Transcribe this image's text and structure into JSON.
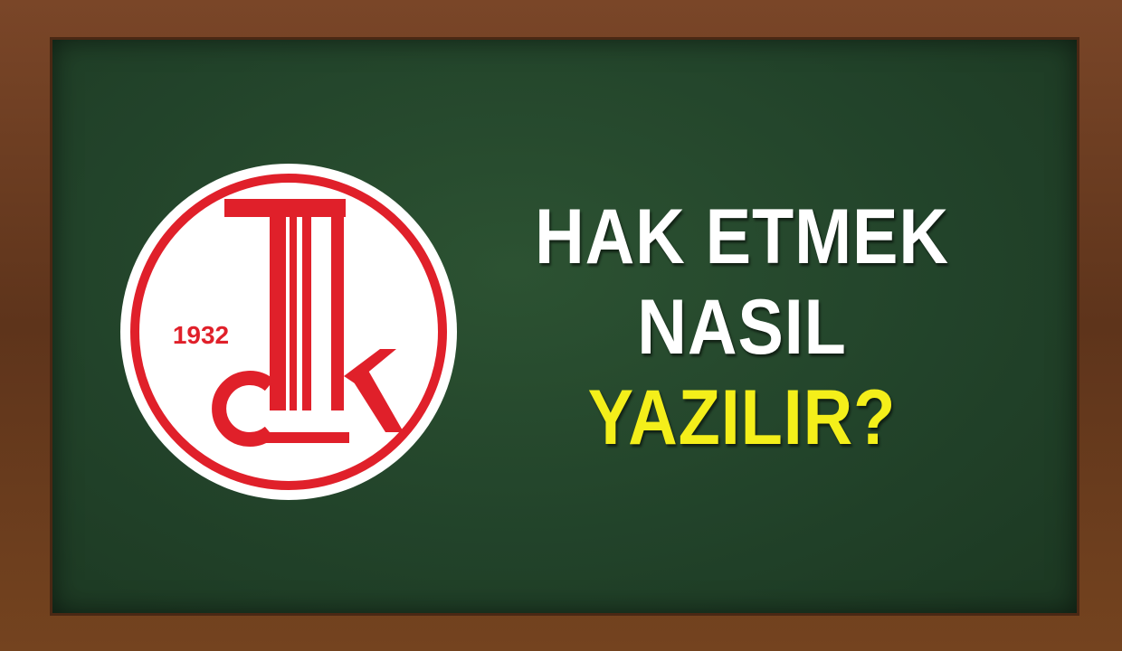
{
  "logo": {
    "year": "1932",
    "brand_color": "#e0202a",
    "background_color": "#ffffff"
  },
  "headline": {
    "line1": "HAK ETMEK",
    "line2": "NASIL",
    "line3": "YAZILIR?",
    "color_primary": "#ffffff",
    "color_accent": "#f4ef1a"
  },
  "board_color": "#22432a",
  "frame_color": "#6b3d22"
}
